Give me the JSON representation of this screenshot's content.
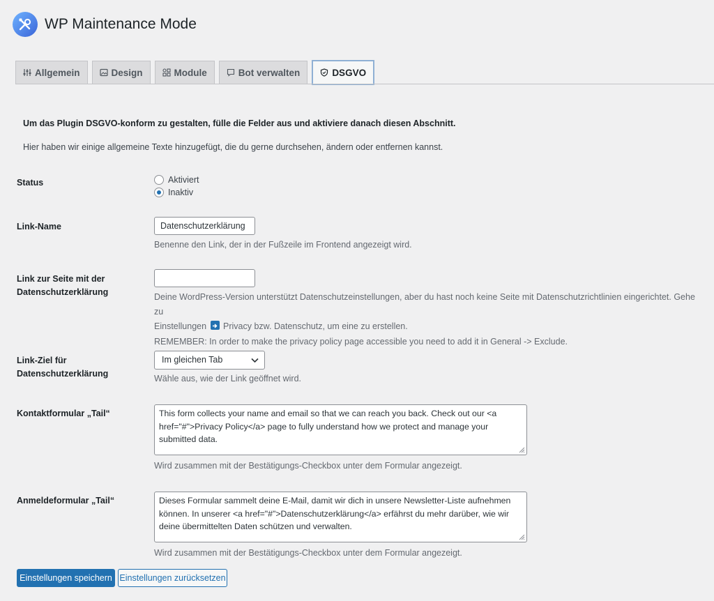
{
  "app": {
    "title": "WP Maintenance Mode"
  },
  "tabs": [
    {
      "label": "Allgemein",
      "icon": "sliders-icon"
    },
    {
      "label": "Design",
      "icon": "image-icon"
    },
    {
      "label": "Module",
      "icon": "modules-icon"
    },
    {
      "label": "Bot verwalten",
      "icon": "chat-icon"
    },
    {
      "label": "DSGVO",
      "icon": "shield-icon",
      "active": true
    }
  ],
  "intro": {
    "bold": "Um das Plugin DSGVO-konform zu gestalten, fülle die Felder aus und aktiviere danach diesen Abschnitt.",
    "text": "Hier haben wir einige allgemeine Texte hinzugefügt, die du gerne durchsehen, ändern oder entfernen kannst."
  },
  "status": {
    "label": "Status",
    "options": [
      "Aktiviert",
      "Inaktiv"
    ],
    "selected": "Inaktiv"
  },
  "link_name": {
    "label": "Link-Name",
    "value": "Datenschutzerklärung",
    "description": "Benenne den Link, der in der Fußzeile im Frontend angezeigt wird."
  },
  "link_page": {
    "label_line1": "Link zur Seite mit der",
    "label_line2": "Datenschutzerklärung",
    "value": "",
    "desc_line1": "Deine WordPress-Version unterstützt Datenschutzeinstellungen, aber du hast noch keine Seite mit Datenschutzrichtlinien eingerichtet. Gehe zu",
    "desc_line2_a": "Einstellungen",
    "desc_line2_b": "Privacy bzw. Datenschutz, um eine zu erstellen.",
    "remember": "REMEMBER: In order to make the privacy policy page accessible you need to add it in General -> Exclude."
  },
  "link_target": {
    "label_line1": "Link-Ziel für",
    "label_line2": "Datenschutzerklärung",
    "value": "Im gleichen Tab",
    "description": "Wähle aus, wie der Link geöffnet wird."
  },
  "contact_tail": {
    "label": "Kontaktformular „Tail“",
    "line1": "This form collects your name and email so that we can reach you back. Check out our <a",
    "line2": "href=\"#\">Privacy Policy</a> page to fully understand how we protect and manage your",
    "line3": "submitted data.",
    "description": "Wird zusammen mit der Bestätigungs-Checkbox unter dem Formular angezeigt."
  },
  "signup_tail": {
    "label": "Anmeldeformular „Tail“",
    "line1": "Dieses Formular sammelt deine E-Mail, damit wir dich in unsere Newsletter-Liste aufnehmen",
    "line2": "können. In unserer <a href=\"#\">Datenschutzerklärung</a> erfährst du mehr darüber, wie wir",
    "line3": "deine übermittelten Daten schützen und verwalten.",
    "description": "Wird zusammen mit der Bestätigungs-Checkbox unter dem Formular angezeigt."
  },
  "buttons": {
    "save": "Einstellungen speichern",
    "reset": "Einstellungen zurücksetzen"
  },
  "colors": {
    "accent": "#2271b1",
    "background": "#f0f0f1"
  }
}
